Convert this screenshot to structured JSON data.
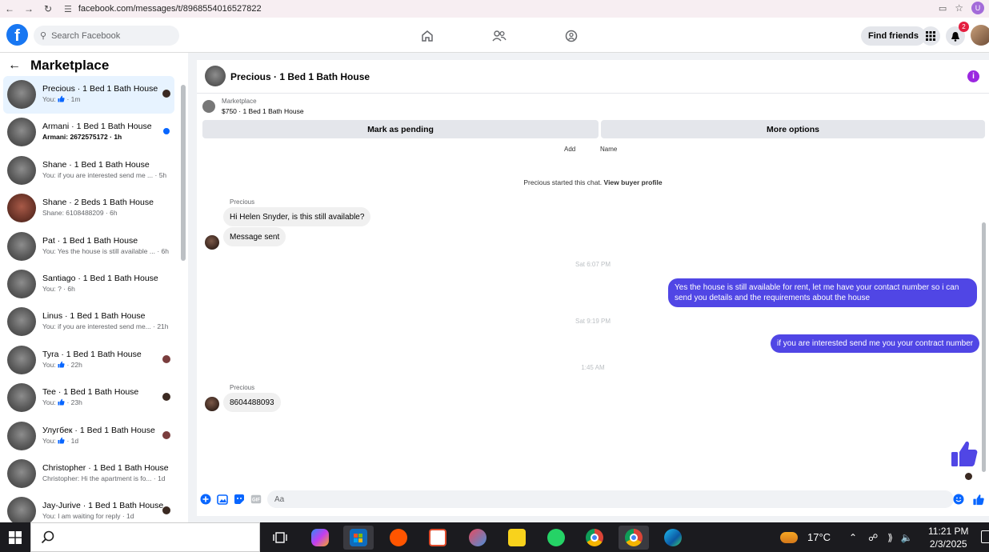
{
  "browser": {
    "url": "facebook.com/messages/t/8968554016527822",
    "profile_initial": "U"
  },
  "fb": {
    "search_placeholder": "Search Facebook",
    "find_friends": "Find friends",
    "notification_count": "2"
  },
  "sidebar": {
    "title": "Marketplace",
    "conversations": [
      {
        "name": "Precious · 1 Bed 1 Bath House",
        "sub_prefix": "You: ",
        "sub_like": true,
        "sub_suffix": " · 1m"
      },
      {
        "name": "Armani · 1 Bed 1 Bath House",
        "sub_prefix": "Armani: 2672575172",
        "sub_like": false,
        "sub_suffix": " · 1h"
      },
      {
        "name": "Shane · 1 Bed 1 Bath House",
        "sub_prefix": "You: if you are interested send me ...",
        "sub_like": false,
        "sub_suffix": " · 5h"
      },
      {
        "name": "Shane · 2 Beds 1 Bath House",
        "sub_prefix": "Shane: 6108488209",
        "sub_like": false,
        "sub_suffix": " · 6h"
      },
      {
        "name": "Pat · 1 Bed 1 Bath House",
        "sub_prefix": "You: Yes the house is still available ...",
        "sub_like": false,
        "sub_suffix": " · 6h"
      },
      {
        "name": "Santiago · 1 Bed 1 Bath House",
        "sub_prefix": "You: ?",
        "sub_like": false,
        "sub_suffix": " · 6h"
      },
      {
        "name": "Linus · 1 Bed 1 Bath House",
        "sub_prefix": "You: if you are interested send me...",
        "sub_like": false,
        "sub_suffix": " · 21h"
      },
      {
        "name": "Tyra · 1 Bed 1 Bath House",
        "sub_prefix": "You: ",
        "sub_like": true,
        "sub_suffix": " · 22h"
      },
      {
        "name": "Tee · 1 Bed 1 Bath House",
        "sub_prefix": "You: ",
        "sub_like": true,
        "sub_suffix": " · 23h"
      },
      {
        "name": "Улугбек · 1 Bed 1 Bath House",
        "sub_prefix": "You: ",
        "sub_like": true,
        "sub_suffix": " · 1d"
      },
      {
        "name": "Christopher · 1 Bed 1 Bath House",
        "sub_prefix": "Christopher: Hi the apartment is fo...",
        "sub_like": false,
        "sub_suffix": " · 1d"
      },
      {
        "name": "Jay-Jurive · 1 Bed 1 Bath House",
        "sub_prefix": "You: I am waiting for reply",
        "sub_like": false,
        "sub_suffix": " · 1d"
      }
    ]
  },
  "chat": {
    "title": "Precious · 1 Bed 1 Bath House",
    "marketplace_label": "Marketplace",
    "listing": "$750 · 1 Bed 1 Bath House",
    "mark_pending": "Mark as pending",
    "more_options": "More options",
    "tip_add": "Add",
    "tip_name": "Name",
    "started_text": "Precious started this chat.",
    "view_profile": "View buyer profile",
    "sender": "Precious",
    "msg1": "Hi Helen Snyder, is this still available?",
    "msg2": "Message sent",
    "ts1": "Sat 6:07 PM",
    "out1": "Yes the house is still available for rent, let me have your contact number  so i can send you details and the requirements about the house",
    "ts2": "Sat 9:19 PM",
    "out2": "if you are interested send me you your contract number",
    "ts3": "1:45 AM",
    "sender2": "Precious",
    "msg3": "8604488093",
    "composer_placeholder": "Aa"
  },
  "taskbar": {
    "temperature": "17°C",
    "time": "11:21 PM",
    "date": "2/3/2025"
  },
  "colors": {
    "fb_blue": "#1877f2",
    "outgoing_bubble": "#5046e5",
    "active_conv": "#e7f3ff"
  }
}
